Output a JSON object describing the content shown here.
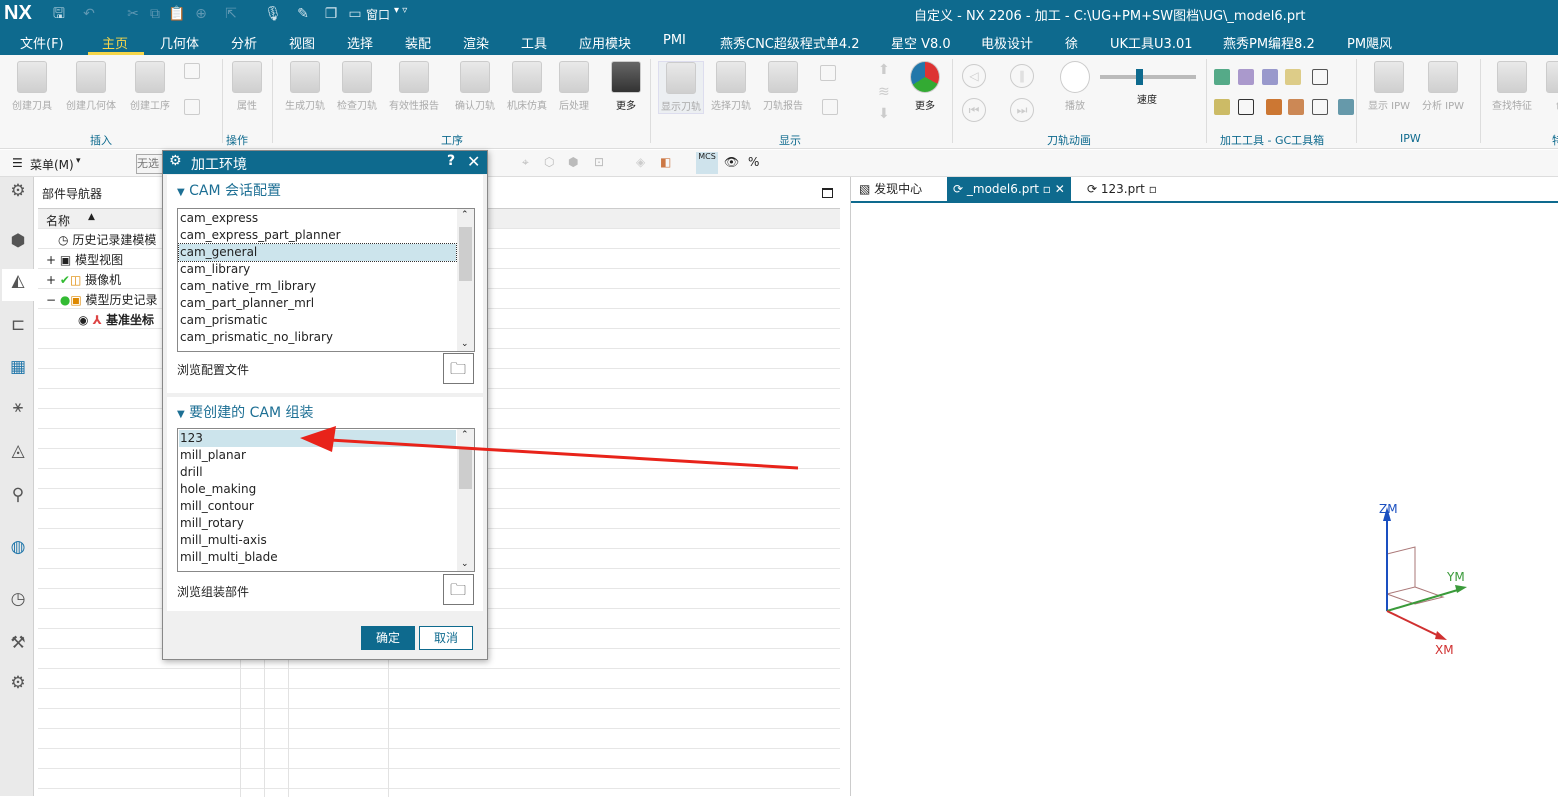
{
  "app": {
    "logo": "NX",
    "title": "自定义 - NX 2206 - 加工 - C:\\UG+PM+SW图档\\UG\\_model6.prt",
    "window_menu": "窗口"
  },
  "menu": [
    "文件(F)",
    "主页",
    "几何体",
    "分析",
    "视图",
    "选择",
    "装配",
    "渲染",
    "工具",
    "应用模块",
    "PMI",
    "燕秀CNC超级程式单4.2",
    "星空 V8.0",
    "电极设计",
    "徐",
    "UK工具U3.01",
    "燕秀PM编程8.2",
    "PM飓风"
  ],
  "menu_active": "主页",
  "ribbon": {
    "buttons": [
      "创建刀具",
      "创建几何体",
      "创建工序",
      "属性",
      "生成刀轨",
      "检查刀轨",
      "有效性报告",
      "确认刀轨",
      "机床仿真",
      "后处理",
      "更多",
      "显示刀轨",
      "选择刀轨",
      "刀轨报告",
      "更多",
      "播放",
      "速度",
      "显示 IPW",
      "分析 IPW",
      "查找特征",
      "创"
    ],
    "groups": [
      "插入",
      "操作",
      "工序",
      "显示",
      "刀轨动画",
      "加工工具 - GC工具箱",
      "IPW",
      "特"
    ],
    "speed_level": 0.4
  },
  "toolbar2": {
    "menu_label": "菜单(M)",
    "filter_placeholder": "无选"
  },
  "navigator": {
    "title": "部件导航器",
    "column": "名称",
    "items": [
      "历史记录建模模",
      "模型视图",
      "摄像机",
      "模型历史记录",
      "基准坐标"
    ]
  },
  "graphics": {
    "tabs": [
      "发现中心",
      "_model6.prt",
      "123.prt"
    ],
    "active_tab": "_model6.prt",
    "axes": {
      "z": "ZM",
      "y": "YM",
      "x": "XM"
    },
    "colors": {
      "x": "#d03030",
      "y": "#3a9a3a",
      "z": "#1a4fc0"
    }
  },
  "dialog": {
    "title": "加工环境",
    "help": "?",
    "section1": {
      "title": "CAM 会话配置",
      "items": [
        "cam_express",
        "cam_express_part_planner",
        "cam_general",
        "cam_library",
        "cam_native_rm_library",
        "cam_part_planner_mrl",
        "cam_prismatic",
        "cam_prismatic_no_library"
      ],
      "selected": "cam_general",
      "browse_label": "浏览配置文件"
    },
    "section2": {
      "title": "要创建的 CAM 组装",
      "items": [
        "123",
        "mill_planar",
        "drill",
        "hole_making",
        "mill_contour",
        "mill_rotary",
        "mill_multi-axis",
        "mill_multi_blade"
      ],
      "selected": "123",
      "browse_label": "浏览组装部件"
    },
    "ok": "确定",
    "cancel": "取消"
  },
  "colors": {
    "brand": "#0e6a8e",
    "menu_active": "#f6d64a",
    "annotation_arrow": "#e8231a"
  }
}
